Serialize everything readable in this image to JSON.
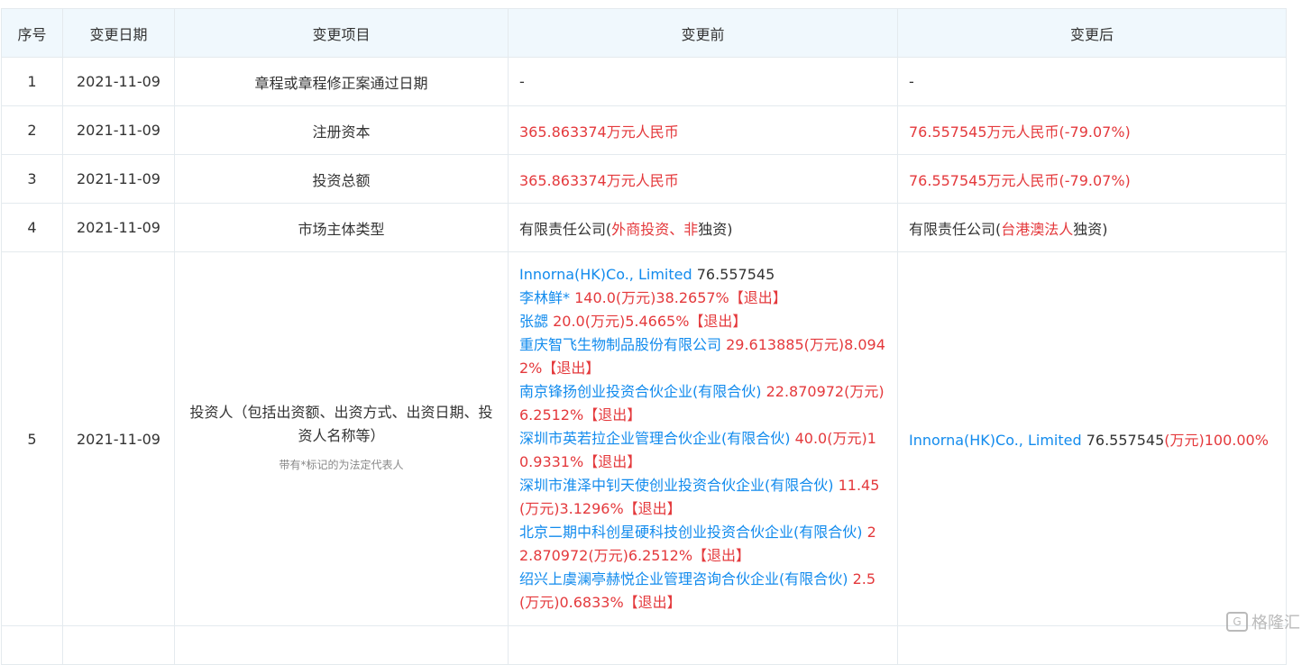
{
  "headers": [
    "序号",
    "变更日期",
    "变更项目",
    "变更前",
    "变更后"
  ],
  "rows": [
    {
      "no": "1",
      "date": "2021-11-09",
      "item": "章程或章程修正案通过日期",
      "before": "-",
      "after": "-"
    },
    {
      "no": "2",
      "date": "2021-11-09",
      "item": "注册资本",
      "before": "365.863374万元人民币",
      "after": "76.557545万元人民币(-79.07%)"
    },
    {
      "no": "3",
      "date": "2021-11-09",
      "item": "投资总额",
      "before": "365.863374万元人民币",
      "after": "76.557545万元人民币(-79.07%)"
    },
    {
      "no": "4",
      "date": "2021-11-09",
      "item": "市场主体类型",
      "before": {
        "prefix": "有限责任公司(",
        "highlight": "外商投资、非",
        "suffix": "独资)"
      },
      "after": {
        "prefix": "有限责任公司(",
        "highlight": "台港澳法人",
        "suffix": "独资)"
      }
    },
    {
      "no": "5",
      "date": "2021-11-09",
      "item": "投资人（包括出资额、出资方式、出资日期、投资人名称等）",
      "note": "带有*标记的为法定代表人",
      "before": [
        {
          "name": "Innorna(HK)Co., Limited",
          "detail": " 76.557545",
          "detail_color": "dark"
        },
        {
          "name": "李林鲜*",
          "detail": " 140.0(万元)38.2657%【退出】"
        },
        {
          "name": "张勰",
          "detail": " 20.0(万元)5.4665%【退出】"
        },
        {
          "name": "重庆智飞生物制品股份有限公司",
          "detail": " 29.613885(万元)8.0942%【退出】"
        },
        {
          "name": "南京锋扬创业投资合伙企业(有限合伙)",
          "detail": " 22.870972(万元)6.2512%【退出】"
        },
        {
          "name": "深圳市英若拉企业管理合伙企业(有限合伙)",
          "detail": " 40.0(万元)10.9331%【退出】"
        },
        {
          "name": "深圳市淮泽中钊天使创业投资合伙企业(有限合伙)",
          "detail": " 11.45(万元)3.1296%【退出】"
        },
        {
          "name": "北京二期中科创星硬科技创业投资合伙企业(有限合伙)",
          "detail": " 22.870972(万元)6.2512%【退出】"
        },
        {
          "name": "绍兴上虞澜亭赫悦企业管理咨询合伙企业(有限合伙)",
          "detail": " 2.5(万元)0.6833%【退出】"
        }
      ],
      "after": {
        "name": "Innorna(HK)Co., Limited",
        "amount": " 76.557545",
        "detail": "(万元)100.00%"
      }
    }
  ],
  "watermark": "格隆汇",
  "colors": {
    "red": "#e4393c",
    "blue": "#128bed",
    "header_bg": "#f0f8fd",
    "border": "#e4eaee"
  }
}
